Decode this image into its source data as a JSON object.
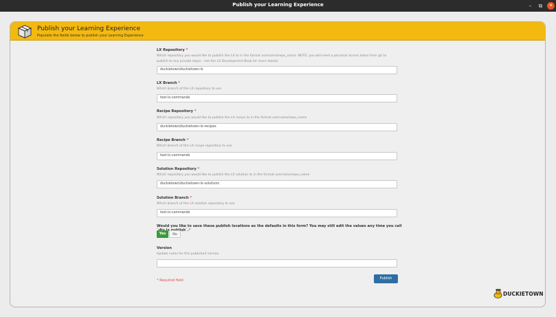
{
  "window": {
    "title": "Publish your Learning Experience",
    "minimize": "–",
    "maximize": "⧉",
    "close": "✕"
  },
  "header": {
    "title": "Publish your Learning Experience",
    "subtitle": "Populate the fields below to publish your Learning Experience"
  },
  "form": {
    "required_mark": "*",
    "fields": [
      {
        "label": "LX Repository",
        "help": "Which repository you would like to publish the LX to in the format username/repo_name. NOTE: you will need a personal access token from git to publish to any private repos - see the LX Development Book for more details.",
        "value": "duckietown/duckietown-lx"
      },
      {
        "label": "LX Branch",
        "help": "Which branch of the LX repository to use",
        "value": "test-lx-commands"
      },
      {
        "label": "Recipe Repository",
        "help": "Which repository you would like to publish the LX recipe to in the format username/repo_name",
        "value": "duckietown/duckietown-lx-recipes"
      },
      {
        "label": "Recipe Branch",
        "help": "Which branch of the LX recipe repository to use",
        "value": "test-lx-commands"
      },
      {
        "label": "Solution Repository",
        "help": "Which repository you would like to publish the LX solution to in the format username/repo_name",
        "value": "duckietown/duckietown-lx-solutions"
      },
      {
        "label": "Solution Branch",
        "help": "Which branch of the LX solution repository to use",
        "value": "test-lx-commands"
      }
    ],
    "save_defaults": {
      "label": "Would you like to save these publish locations as the defaults in this form? You may still edit the values any time you call `dts lx publish`.",
      "yes": "Yes",
      "no": "No",
      "selected": "Yes"
    },
    "version": {
      "label": "Version",
      "help": "Update notes for this published version",
      "value": ""
    },
    "required_note": "* Required field",
    "publish_label": "Publish"
  },
  "brand": {
    "name": "DUCKIETOWN",
    "accent": "#f4b90f"
  },
  "colors": {
    "header": "#f4b90f",
    "yes_button": "#3c9a3c",
    "publish_button": "#2f6ea4",
    "required": "#d9534f"
  }
}
